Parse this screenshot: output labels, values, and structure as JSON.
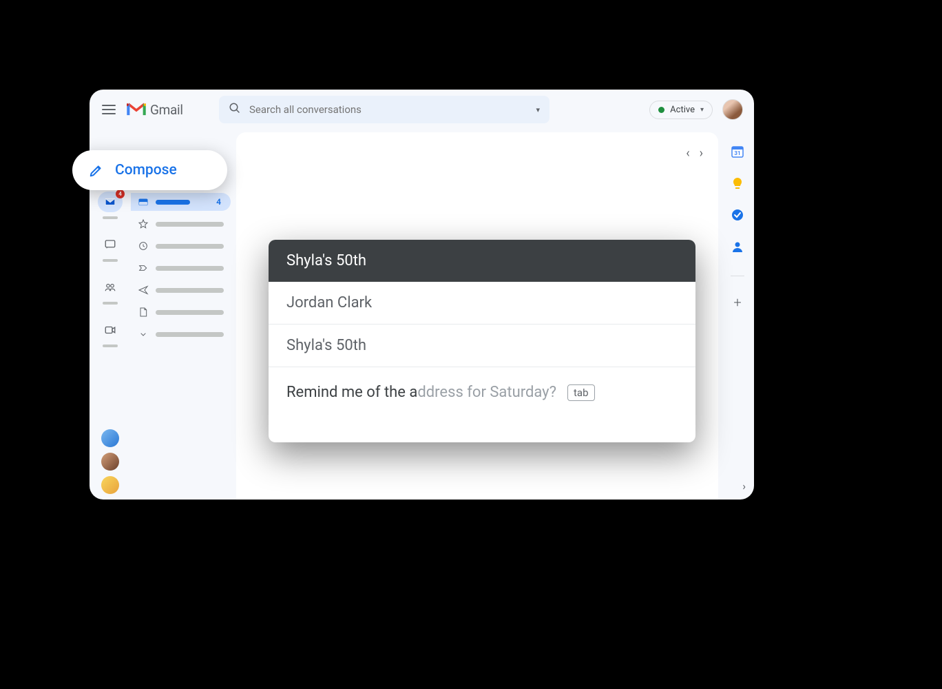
{
  "header": {
    "app_name": "Gmail",
    "search_placeholder": "Search all conversations",
    "status_label": "Active"
  },
  "rail": {
    "mail_badge": "4"
  },
  "folders": {
    "inbox_count": "4"
  },
  "compose": {
    "button_label": "Compose",
    "window_title": "Shyla's 50th",
    "to_field": "Jordan Clark",
    "subject_field": "Shyla's 50th",
    "body_typed": "Remind me of the a",
    "body_suggested": "ddress for Saturday?",
    "tab_hint": "tab"
  }
}
